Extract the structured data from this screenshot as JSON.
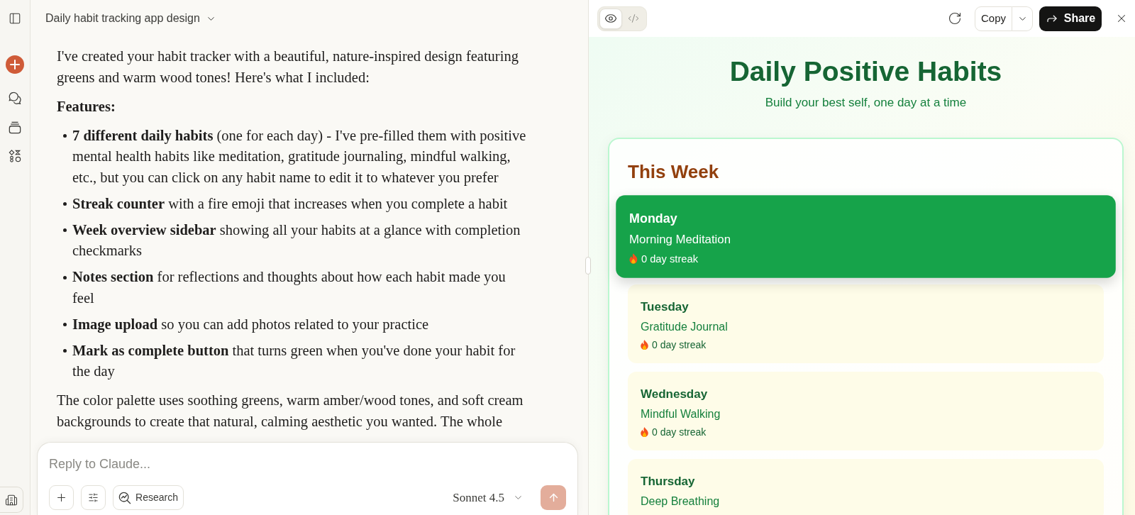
{
  "chat": {
    "title": "Daily habit tracking app design",
    "message": [
      {
        "kind": "paragraph",
        "text": "I've created your habit tracker with a beautiful, nature-inspired design featuring greens and warm wood tones! Here's what I included:"
      },
      {
        "kind": "heading",
        "text": "Features:"
      },
      {
        "kind": "list",
        "items": [
          "**7 different daily habits** (one for each day) - I've pre-filled them with positive mental health habits like meditation, gratitude journaling, mindful walking, etc., but you can click on any habit name to edit it to whatever you prefer",
          "**Streak counter** with a fire emoji that increases when you complete a habit",
          "**Week overview sidebar** showing all your habits at a glance with completion checkmarks",
          "**Notes section** for reflections and thoughts about how each habit made you feel",
          "**Image upload** so you can add photos related to your practice",
          "**Mark as complete button** that turns green when you've done your habit for the day"
        ]
      },
      {
        "kind": "paragraph",
        "text": "The color palette uses soothing greens, warm amber/wood tones, and soft cream backgrounds to create that natural, calming aesthetic you wanted. The whole"
      }
    ]
  },
  "composer": {
    "placeholder": "Reply to Claude...",
    "research_button": "Research",
    "model": "Sonnet 4.5"
  },
  "artifact": {
    "view_toggle": [
      {
        "kind": "preview",
        "selected": true
      },
      {
        "kind": "code",
        "selected": false
      }
    ],
    "copy_button": "Copy",
    "share_button": "Share",
    "preview": {
      "title": "Daily Positive Habits",
      "subtitle": "Build your best self, one day at a time",
      "section_title": "This Week",
      "days": [
        {
          "day": "Monday",
          "habit": "Morning Meditation",
          "streak": "0 day streak",
          "selected": true
        },
        {
          "day": "Tuesday",
          "habit": "Gratitude Journal",
          "streak": "0 day streak",
          "selected": false
        },
        {
          "day": "Wednesday",
          "habit": "Mindful Walking",
          "streak": "0 day streak",
          "selected": false
        },
        {
          "day": "Thursday",
          "habit": "Deep Breathing",
          "selected": false
        }
      ]
    }
  }
}
